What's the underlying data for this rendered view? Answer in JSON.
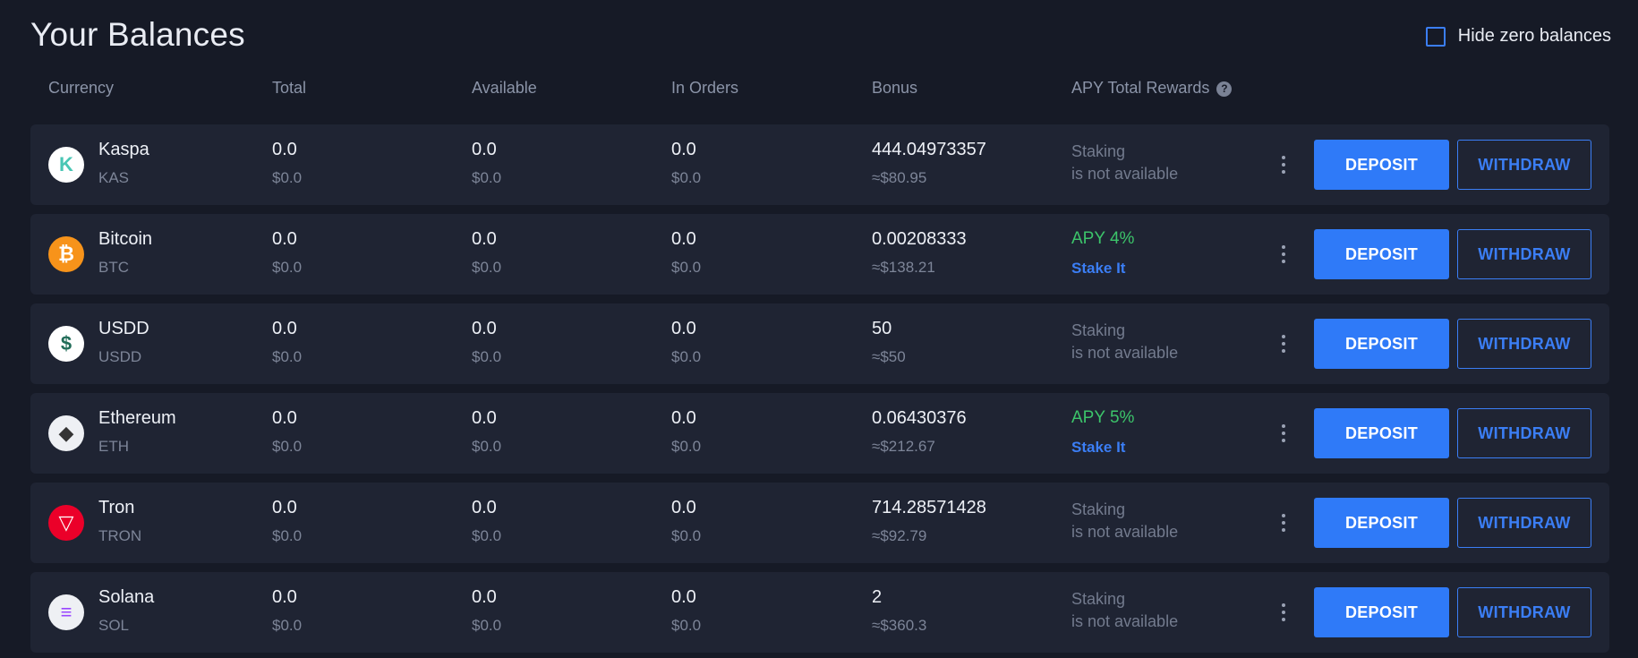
{
  "title": "Your Balances",
  "hide_zero": {
    "label": "Hide zero balances",
    "checked": false
  },
  "headers": {
    "currency": "Currency",
    "total": "Total",
    "available": "Available",
    "in_orders": "In Orders",
    "bonus": "Bonus",
    "apy": "APY Total Rewards",
    "help": "?"
  },
  "buttons": {
    "deposit": "DEPOSIT",
    "withdraw": "WITHDRAW"
  },
  "rows": [
    {
      "name": "Kaspa",
      "ticker": "KAS",
      "icon": "kaspa-icon",
      "icon_color": "#ffffff",
      "icon_glyph": "K",
      "icon_glyph_color": "#49c6b4",
      "total": "0.0",
      "total_usd": "$0.0",
      "available": "0.0",
      "available_usd": "$0.0",
      "in_orders": "0.0",
      "in_orders_usd": "$0.0",
      "bonus": "444.04973357",
      "bonus_usd": "≈$80.95",
      "staking": false,
      "staking_line1": "Staking",
      "staking_line2": "is not available"
    },
    {
      "name": "Bitcoin",
      "ticker": "BTC",
      "icon": "bitcoin-icon",
      "icon_color": "#f7931a",
      "icon_glyph": "₿",
      "icon_glyph_color": "#ffffff",
      "total": "0.0",
      "total_usd": "$0.0",
      "available": "0.0",
      "available_usd": "$0.0",
      "in_orders": "0.0",
      "in_orders_usd": "$0.0",
      "bonus": "0.00208333",
      "bonus_usd": "≈$138.21",
      "staking": true,
      "apy": "APY 4%",
      "stake_label": "Stake It"
    },
    {
      "name": "USDD",
      "ticker": "USDD",
      "icon": "usdd-icon",
      "icon_color": "#ffffff",
      "icon_glyph": "$",
      "icon_glyph_color": "#216c58",
      "total": "0.0",
      "total_usd": "$0.0",
      "available": "0.0",
      "available_usd": "$0.0",
      "in_orders": "0.0",
      "in_orders_usd": "$0.0",
      "bonus": "50",
      "bonus_usd": "≈$50",
      "staking": false,
      "staking_line1": "Staking",
      "staking_line2": "is not available"
    },
    {
      "name": "Ethereum",
      "ticker": "ETH",
      "icon": "ethereum-icon",
      "icon_color": "#eef0f4",
      "icon_glyph": "◆",
      "icon_glyph_color": "#343434",
      "total": "0.0",
      "total_usd": "$0.0",
      "available": "0.0",
      "available_usd": "$0.0",
      "in_orders": "0.0",
      "in_orders_usd": "$0.0",
      "bonus": "0.06430376",
      "bonus_usd": "≈$212.67",
      "staking": true,
      "apy": "APY 5%",
      "stake_label": "Stake It"
    },
    {
      "name": "Tron",
      "ticker": "TRON",
      "icon": "tron-icon",
      "icon_color": "#eb0029",
      "icon_glyph": "▽",
      "icon_glyph_color": "#ffffff",
      "total": "0.0",
      "total_usd": "$0.0",
      "available": "0.0",
      "available_usd": "$0.0",
      "in_orders": "0.0",
      "in_orders_usd": "$0.0",
      "bonus": "714.28571428",
      "bonus_usd": "≈$92.79",
      "staking": false,
      "staking_line1": "Staking",
      "staking_line2": "is not available"
    },
    {
      "name": "Solana",
      "ticker": "SOL",
      "icon": "solana-icon",
      "icon_color": "#eef0f4",
      "icon_glyph": "≡",
      "icon_glyph_color": "#9945ff",
      "total": "0.0",
      "total_usd": "$0.0",
      "available": "0.0",
      "available_usd": "$0.0",
      "in_orders": "0.0",
      "in_orders_usd": "$0.0",
      "bonus": "2",
      "bonus_usd": "≈$360.3",
      "staking": false,
      "staking_line1": "Staking",
      "staking_line2": "is not available"
    }
  ]
}
